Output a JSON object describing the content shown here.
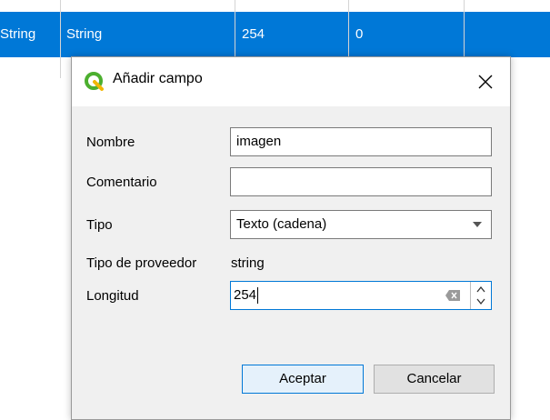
{
  "table": {
    "cells": [
      "String",
      "String",
      "254",
      "0"
    ]
  },
  "dialog": {
    "title": "Añadir campo",
    "fields": {
      "nombre_label": "Nombre",
      "nombre_value": "imagen",
      "comentario_label": "Comentario",
      "comentario_value": "",
      "tipo_label": "Tipo",
      "tipo_value": "Texto (cadena)",
      "proveedor_label": "Tipo de proveedor",
      "proveedor_value": "string",
      "longitud_label": "Longitud",
      "longitud_value": "254"
    },
    "buttons": {
      "accept": "Aceptar",
      "cancel": "Cancelar"
    }
  },
  "colors": {
    "selection": "#0078d7",
    "qgis_green": "#4caf2f"
  }
}
